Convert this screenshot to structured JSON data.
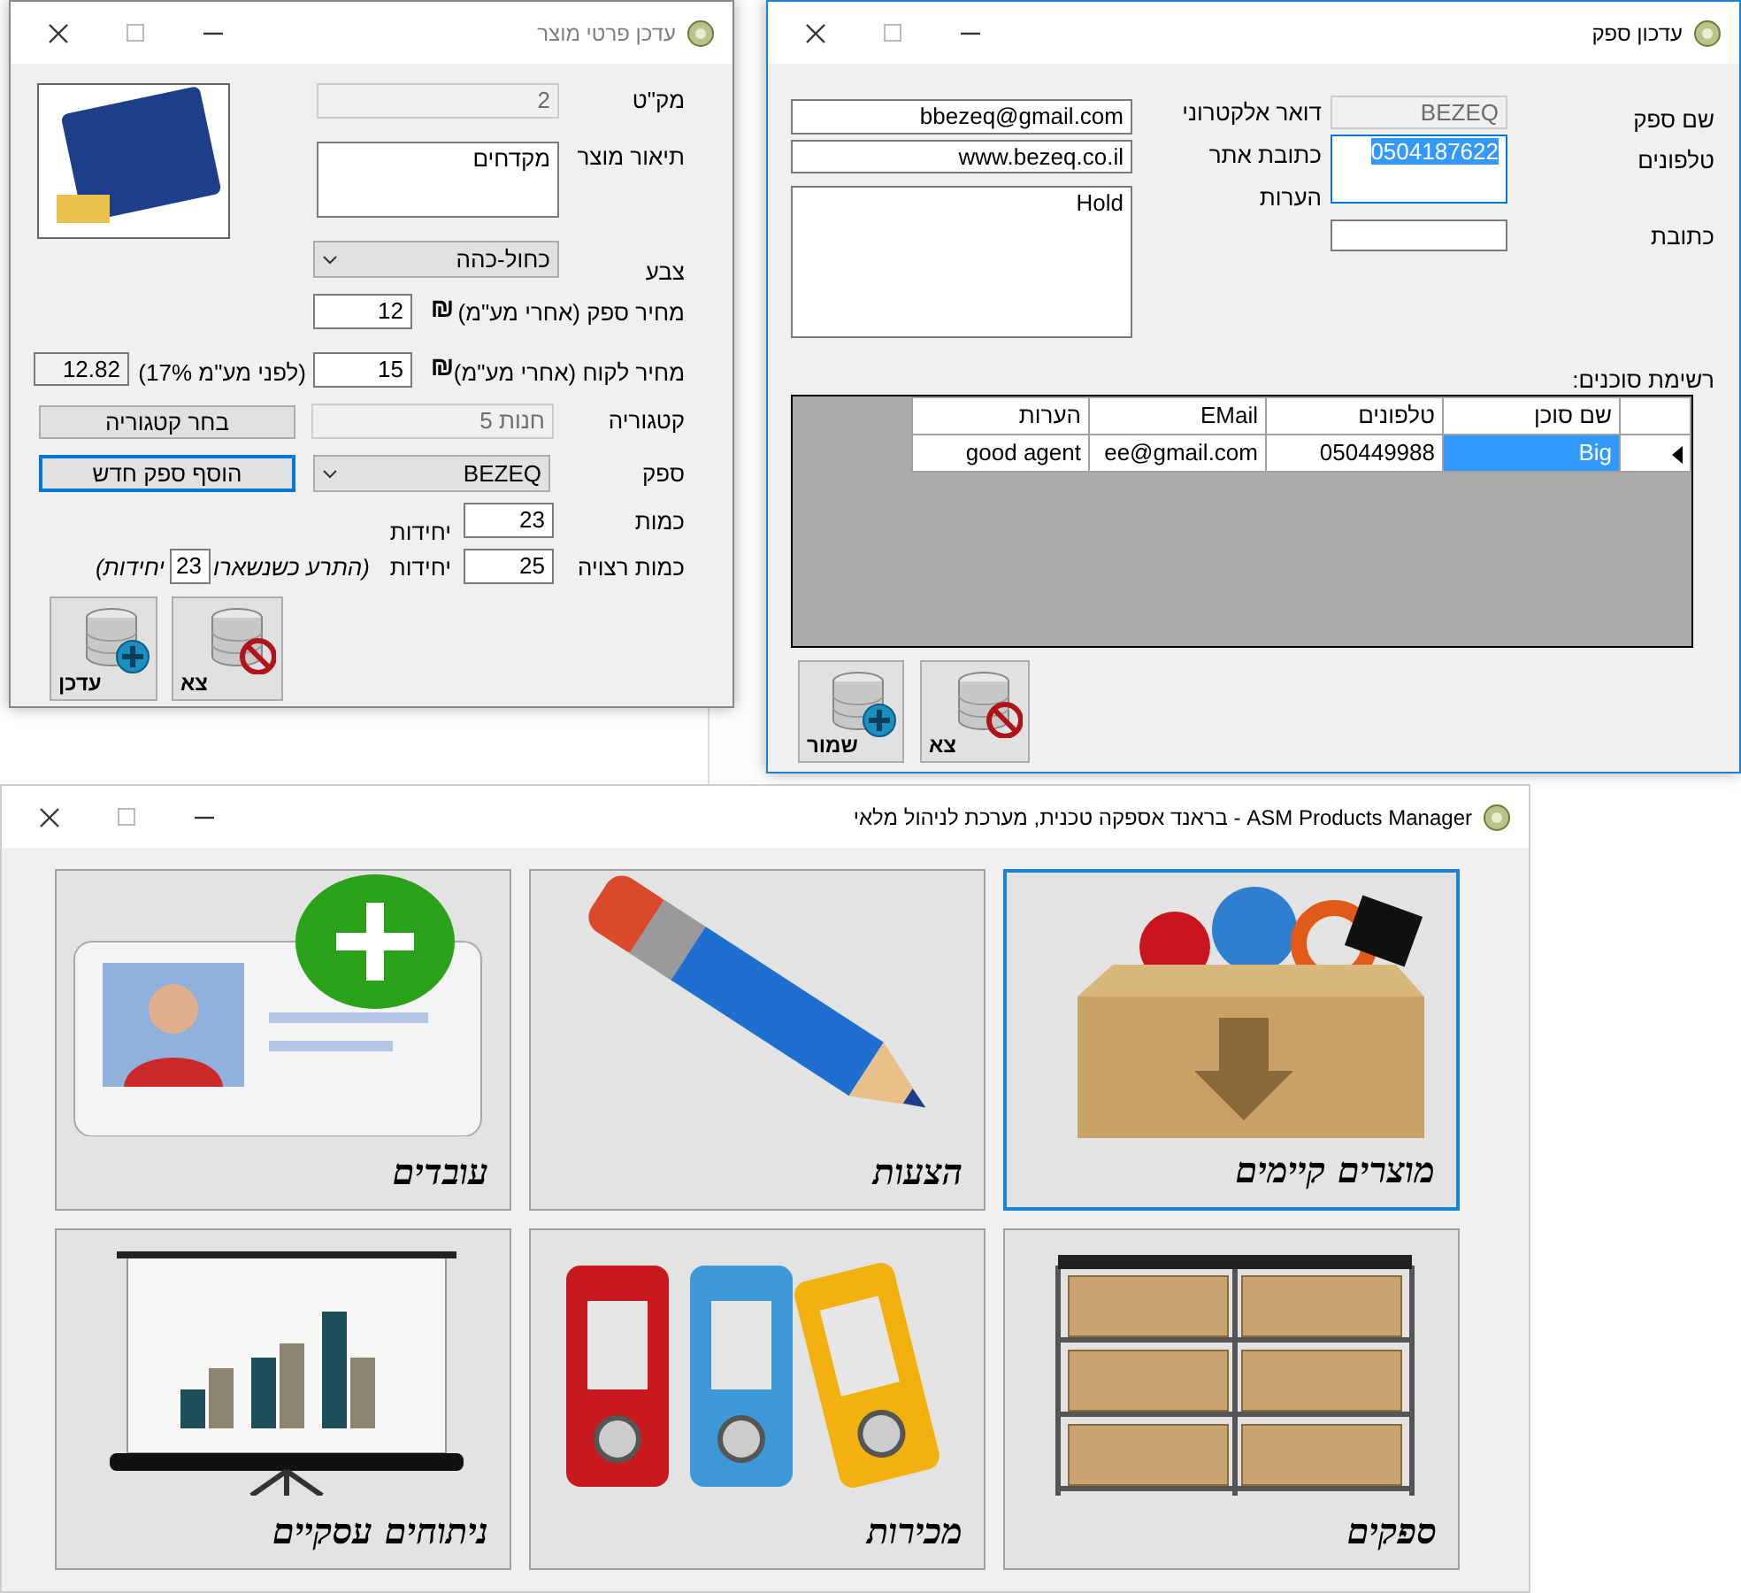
{
  "product_window": {
    "title": "עדכן פרטי מוצר",
    "active": false,
    "sku": {
      "label": "מק\"ט",
      "value": "2",
      "disabled": true
    },
    "description": {
      "label": "תיאור מוצר",
      "value": "מקדחים"
    },
    "color": {
      "label": "צבע",
      "value": "כחול-כהה"
    },
    "supplier_price": {
      "label": "מחיר ספק (אחרי מע\"מ)",
      "value": "12",
      "currency": "₪"
    },
    "customer_price": {
      "label": "מחיר לקוח (אחרי מע\"מ)",
      "value": "15",
      "currency": "₪",
      "pre_vat_label": "(לפני מע\"מ 17%)",
      "pre_vat_value": "12.82"
    },
    "category": {
      "label": "קטגוריה",
      "value": "חנות 5",
      "disabled": true,
      "button": "בחר קטגוריה"
    },
    "supplier": {
      "label": "ספק",
      "value": "BEZEQ",
      "button": "הוסף ספק חדש",
      "button_focused": true
    },
    "quantity": {
      "label": "כמות",
      "value": "23",
      "unit": "יחידות"
    },
    "desired_quantity": {
      "label": "כמות רצויה",
      "value": "25",
      "unit": "יחידות",
      "alert_label": "(התרע כשנשארו",
      "alert_value": "23",
      "alert_unit": "יחידות)"
    },
    "buttons": [
      {
        "label": "צא",
        "kind": "exit"
      },
      {
        "label": "עדכן",
        "kind": "add"
      }
    ]
  },
  "supplier_window": {
    "title": "עדכון ספק",
    "active": true,
    "name": {
      "label": "שם ספק",
      "value": "BEZEQ",
      "disabled": true
    },
    "phones": {
      "label": "טלפונים",
      "value": "0504187622",
      "focused": true
    },
    "address": {
      "label": "כתובת"
    },
    "email": {
      "label": "דואר אלקטרוני",
      "value": "bbezeq@gmail.com"
    },
    "website": {
      "label": "כתובת אתר",
      "value": "www.bezeq.co.il"
    },
    "notes": {
      "label": "הערות",
      "value": "Hold"
    },
    "agents": {
      "label": "רשימת סוכנים:",
      "columns": [
        "שם סוכן",
        "טלפונים",
        "EMail",
        "הערות"
      ],
      "rows": [
        {
          "current": true,
          "cells": [
            {
              "text": "Big",
              "selected": true
            },
            {
              "text": "050449988",
              "selected": false
            },
            {
              "text": "ee@gmail.com",
              "selected": false
            },
            {
              "text": "good agent",
              "selected": false
            }
          ]
        }
      ]
    },
    "buttons": [
      {
        "label": "צא",
        "kind": "exit"
      },
      {
        "label": "שמור",
        "kind": "add"
      }
    ]
  },
  "main_window": {
    "title": "ASM Products Manager - בראנד אספקה טכנית, מערכת לניהול מלאי",
    "active": true,
    "tiles": [
      {
        "label": "מוצרים קיימים",
        "kind": "products",
        "selected": true
      },
      {
        "label": "הצעות",
        "kind": "offers",
        "selected": false
      },
      {
        "label": "עובדים",
        "kind": "employees",
        "selected": false
      },
      {
        "label": "ספקים",
        "kind": "suppliers",
        "selected": false
      },
      {
        "label": "מכירות",
        "kind": "sales",
        "selected": false
      },
      {
        "label": "ניתוחים עסקיים",
        "kind": "analytics",
        "selected": false
      }
    ]
  }
}
